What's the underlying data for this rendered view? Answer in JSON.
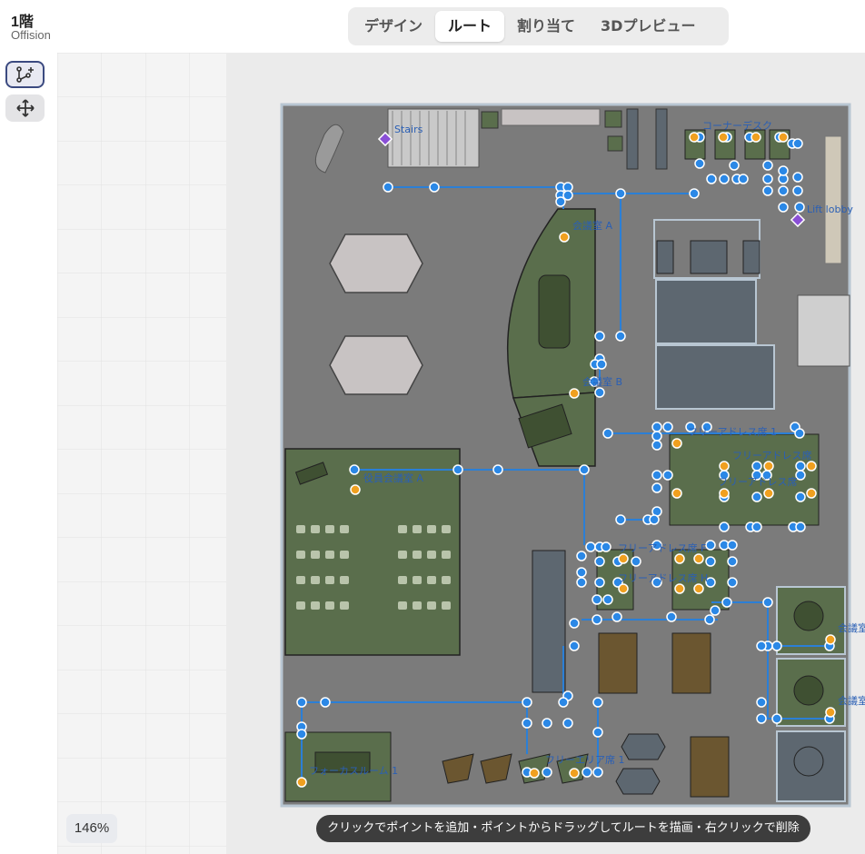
{
  "header": {
    "floor_title": "1階",
    "floor_subtitle": "Offision"
  },
  "tabs": [
    {
      "label": "デザイン",
      "active": false
    },
    {
      "label": "ルート",
      "active": true
    },
    {
      "label": "割り当て",
      "active": false
    },
    {
      "label": "3Dプレビュー",
      "active": false
    }
  ],
  "toolbar": {
    "route_tool": "route-add-icon",
    "move_tool": "move-icon"
  },
  "zoom": {
    "level": "146%"
  },
  "hint": {
    "text": "クリックでポイントを追加・ポイントからドラッグしてルートを描画・右クリックで削除"
  },
  "floorplan": {
    "labels": {
      "stairs": "Stairs",
      "lift_lobby": "Lift lobby",
      "room_a": "会議室 A",
      "room_b": "会議室 B",
      "exec_room_a": "役員会議室 A",
      "desk_row_1": "フリーアドレス席 1",
      "desk_row_2": "フリーアドレス席",
      "desk_row_3": "フリーアドレス席",
      "desk_group_f": "フリーアドレス席 F",
      "desk_group_h": "フリーアドレス席 H",
      "room_right_1": "会議室",
      "room_right_2": "会議室",
      "focus_room": "フォーカスルーム 1",
      "corner_desk": "コーナーデスク",
      "free_area": "フリーエリア席 1"
    },
    "colors": {
      "route": "#2b7fd6",
      "node": "#2b88e6",
      "anchor": "#f0a020",
      "marker": "#8a4fd6",
      "room_fill": "#5a6e4c",
      "floor_fill": "#7b7b7b"
    }
  }
}
